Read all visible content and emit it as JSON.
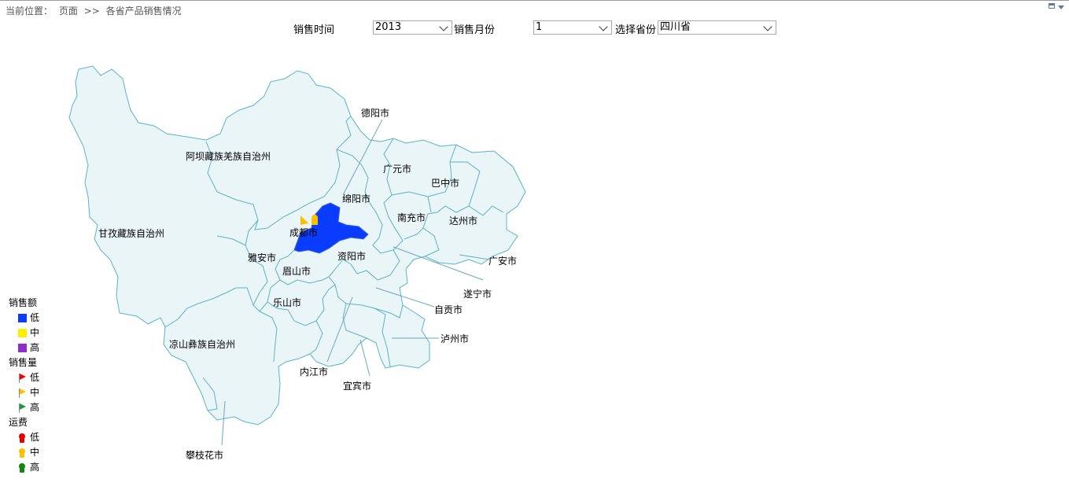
{
  "breadcrumb": {
    "prefix": "当前位置：",
    "page": "页面",
    "sep": ">>",
    "current": "各省产品销售情况"
  },
  "filters": {
    "time_label": "销售时间",
    "time_value": "2013",
    "month_label": "销售月份",
    "month_value": "1",
    "province_label": "选择省份",
    "province_value": "四川省"
  },
  "map": {
    "regions": {
      "aba": "阿坝藏族羌族自治州",
      "ganzi": "甘孜藏族自治州",
      "liangshan": "凉山彝族自治州",
      "deyang": "德阳市",
      "guangyuan": "广元市",
      "bazhong": "巴中市",
      "mianyang": "绵阳市",
      "nanchong": "南充市",
      "dazhou": "达州市",
      "chengdu": "成都市",
      "ziyang": "资阳市",
      "guangan": "广安市",
      "yaan": "雅安市",
      "meishan": "眉山市",
      "suining": "遂宁市",
      "leshan": "乐山市",
      "zigong": "自贡市",
      "luzhou": "泸州市",
      "neijiang": "内江市",
      "yibin": "宜宾市",
      "panzhihua": "攀枝花市"
    },
    "highlighted_region": "成都市",
    "highlight_color": "#0a3cff"
  },
  "legend": {
    "sales_amount": {
      "title": "销售额",
      "items": [
        {
          "label": "低",
          "color": "#0a3cff"
        },
        {
          "label": "中",
          "color": "#ffee00"
        },
        {
          "label": "高",
          "color": "#8b2fc9"
        }
      ]
    },
    "sales_volume": {
      "title": "销售量",
      "items": [
        {
          "label": "低",
          "color": "#ff0000"
        },
        {
          "label": "中",
          "color": "#ffc000"
        },
        {
          "label": "高",
          "color": "#1e9a3c"
        }
      ]
    },
    "freight": {
      "title": "运费",
      "items": [
        {
          "label": "低",
          "color": "#e60000"
        },
        {
          "label": "中",
          "color": "#ffc000"
        },
        {
          "label": "高",
          "color": "#118811"
        }
      ]
    }
  },
  "markers": {
    "flag_color": "#ffc000",
    "pin_color": "#ffc000"
  }
}
